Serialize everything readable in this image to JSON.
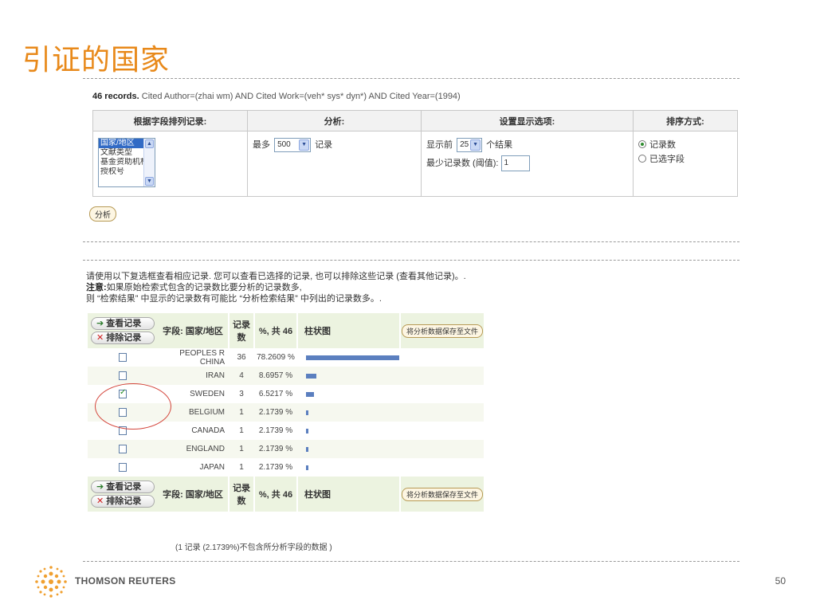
{
  "slide": {
    "title": "引证的国家",
    "page_number": "50",
    "brand": "THOMSON REUTERS"
  },
  "query": {
    "count": "46 records.",
    "text": "Cited Author=(zhai wm) AND Cited Work=(veh* sys* dyn*) AND Cited Year=(1994)"
  },
  "options": {
    "headers": [
      "根据字段排列记录:",
      "分析:",
      "设置显示选项:",
      "排序方式:"
    ],
    "field_list": [
      "国家/地区",
      "文献类型",
      "基金资助机构",
      "授权号"
    ],
    "analyze_prefix": "最多",
    "analyze_value": "500",
    "analyze_suffix": "记录",
    "display_prefix": "显示前",
    "display_value": "25",
    "display_suffix": "个结果",
    "min_label": "最少记录数 (阈值):",
    "min_value": "1",
    "sort_options": [
      "记录数",
      "已选字段"
    ],
    "analyze_button": "分析"
  },
  "notes": {
    "line1": "请使用以下复选框查看相应记录. 您可以查看已选择的记录, 也可以排除这些记录 (查看其他记录)。.",
    "note_label": "注意:",
    "line2": "如果原始检索式包含的记录数比要分析的记录数多,",
    "line3": "则 “检索结果” 中显示的记录数有可能比 “分析检索结果” 中列出的记录数多。."
  },
  "results": {
    "view_button": "查看记录",
    "exclude_button": "排除记录",
    "col_field": "字段: 国家/地区",
    "col_count": "记录数",
    "col_pct": "%, 共 46",
    "col_chart": "柱状图",
    "save_button": "将分析数据保存至文件",
    "rows": [
      {
        "country": "PEOPLES R CHINA",
        "count": "36",
        "pct": "78.2609 %",
        "share": 0.782609,
        "checked": false
      },
      {
        "country": "IRAN",
        "count": "4",
        "pct": "8.6957 %",
        "share": 0.086957,
        "checked": false
      },
      {
        "country": "SWEDEN",
        "count": "3",
        "pct": "6.5217 %",
        "share": 0.065217,
        "checked": true
      },
      {
        "country": "BELGIUM",
        "count": "1",
        "pct": "2.1739 %",
        "share": 0.021739,
        "checked": false
      },
      {
        "country": "CANADA",
        "count": "1",
        "pct": "2.1739 %",
        "share": 0.021739,
        "checked": false
      },
      {
        "country": "ENGLAND",
        "count": "1",
        "pct": "2.1739 %",
        "share": 0.021739,
        "checked": false
      },
      {
        "country": "JAPAN",
        "count": "1",
        "pct": "2.1739 %",
        "share": 0.021739,
        "checked": false
      }
    ],
    "footnote": "(1 记录 (2.1739%)不包含所分析字段的数据 )"
  },
  "colors": {
    "title": "#e8891a",
    "bar": "#5b7fbf",
    "highlight_circle": "#d4463c"
  }
}
